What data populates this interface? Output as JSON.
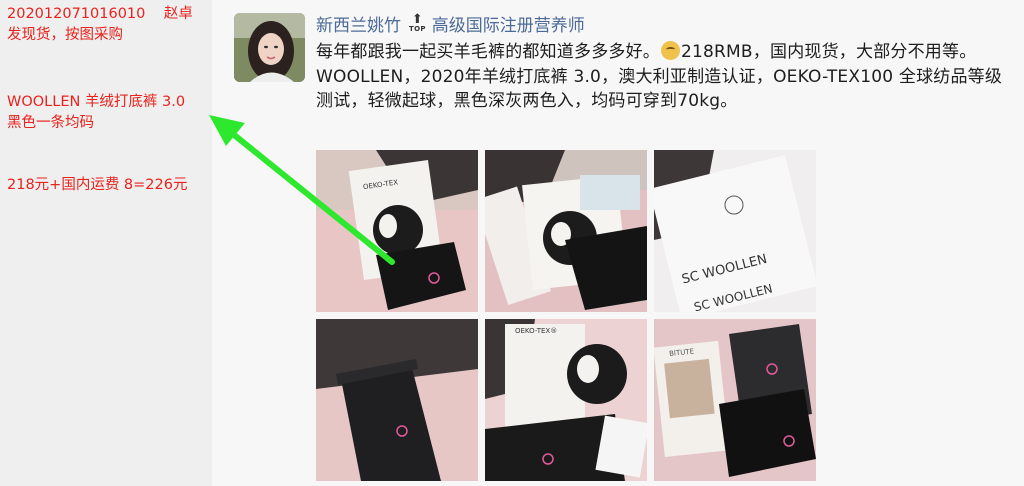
{
  "notes": {
    "order_line1": "202012071016010    赵卓",
    "order_line2": "发现货，按图采购",
    "product_line1": "WOOLLEN 羊绒打底裤 3.0",
    "product_line2": "黑色一条均码",
    "price_line": "218元+国内运费 8=226元"
  },
  "post": {
    "author": "新西兰姚竹",
    "badge_text": "TOP",
    "author_title": "高级国际注册营养师",
    "body_before_emoji": "每年都跟我一起买羊毛裤的都知道多多多好。",
    "emoji_name": "thinking-face-emoji",
    "body_after_emoji": "218RMB，国内现货，大部分不用等。WOOLLEN，2020年羊绒打底裤 3.0，澳大利亚制造认证，OEKO-TEX100 全球纺品等级测试，轻微起球，黑色深灰两色入，均码可穿到70kg。"
  },
  "photos": [
    {
      "name": "photo-1",
      "label": "OEKO-TEX"
    },
    {
      "name": "photo-2",
      "label": ""
    },
    {
      "name": "photo-3",
      "label": "SC WOOLLEN"
    },
    {
      "name": "photo-4",
      "label": ""
    },
    {
      "name": "photo-5",
      "label": "OEKO-TEX®"
    },
    {
      "name": "photo-6",
      "label": "BITUTE"
    }
  ],
  "colors": {
    "annotation_red": "#e8221c",
    "author_blue": "#4c6a98",
    "arrow_green": "#2ee82e"
  }
}
